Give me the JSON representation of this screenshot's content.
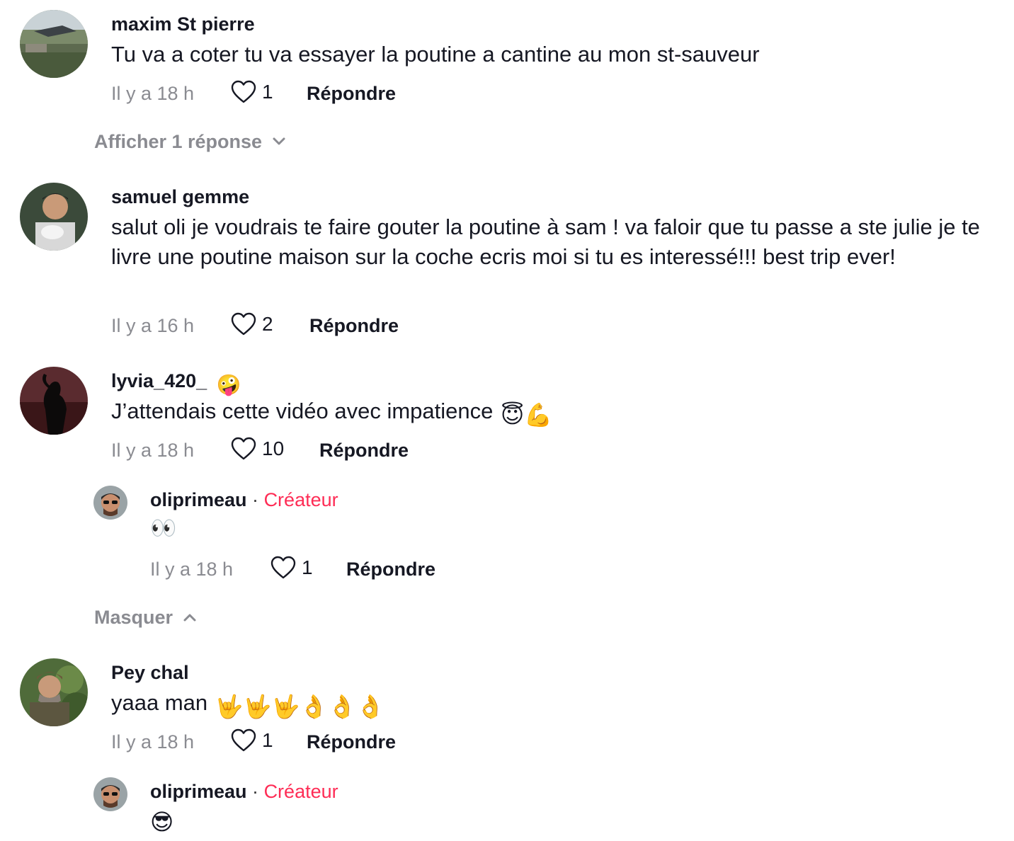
{
  "comments": [
    {
      "username": "maxim St pierre",
      "text": "Tu va a coter tu va essayer la poutine a cantine au mon st-sauveur",
      "time": "Il y a 18 h",
      "likes": "1",
      "reply_label": "Répondre",
      "toggle_label": "Afficher 1 réponse"
    },
    {
      "username": "samuel gemme",
      "text": "salut oli je voudrais te faire gouter la poutine à sam ! va faloir que tu passe a ste julie je te livre une poutine maison sur la coche ecris moi si tu es interessé!!! best trip ever!",
      "time": "Il y a 16 h",
      "likes": "2",
      "reply_label": "Répondre"
    },
    {
      "username": "lyvia_420_",
      "username_emoji": "🤪",
      "text": "J’attendais cette vidéo avec impatience",
      "text_emojis": "😇💪",
      "time": "Il y a 18 h",
      "likes": "10",
      "reply_label": "Répondre",
      "reply": {
        "username": "oliprimeau",
        "badge": "Créateur",
        "separator": "·",
        "text": "👀",
        "time": "Il y a 18 h",
        "likes": "1",
        "reply_label": "Répondre"
      },
      "toggle_label": "Masquer"
    },
    {
      "username": "Pey chal",
      "text": "yaaa man",
      "text_emojis": "🤟🤟🤟👌👌👌",
      "time": "Il y a 18 h",
      "likes": "1",
      "reply_label": "Répondre",
      "reply": {
        "username": "oliprimeau",
        "badge": "Créateur",
        "separator": "·",
        "text": "😎"
      }
    }
  ],
  "icons": {
    "like": "heart-outline-icon",
    "expand": "chevron-down-icon",
    "collapse": "chevron-up-icon"
  },
  "colors": {
    "creator_badge": "#FE2C55",
    "meta_text": "#8A8B91",
    "primary_text": "#161823"
  }
}
